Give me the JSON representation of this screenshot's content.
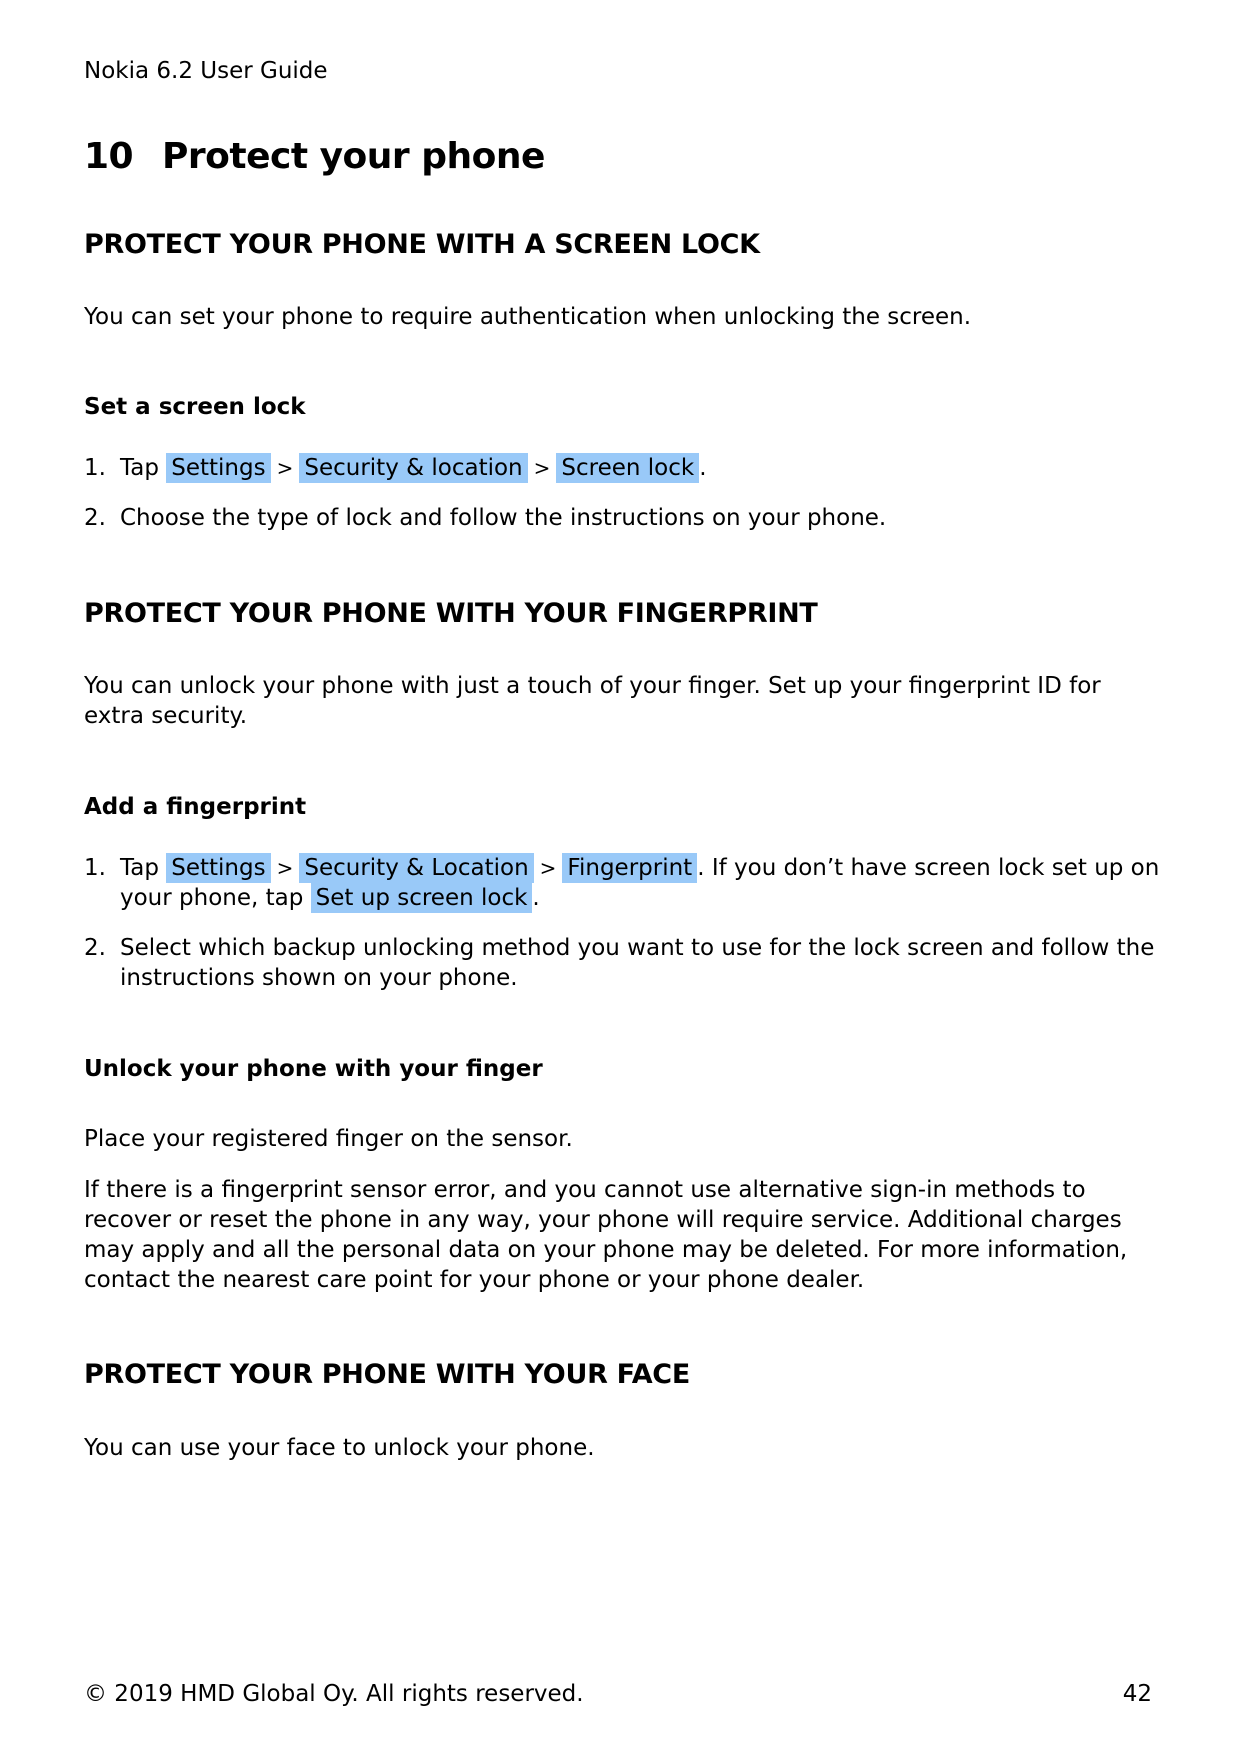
{
  "header": {
    "doc_title": "Nokia 6.2 User Guide"
  },
  "chapter": {
    "number": "10",
    "title": "Protect your phone"
  },
  "sections": {
    "screen_lock": {
      "heading": "PROTECT YOUR PHONE WITH A SCREEN LOCK",
      "intro": "You can set your phone to require authentication when unlocking the screen.",
      "subheading": "Set a screen lock",
      "steps": [
        {
          "number": "1.",
          "prefix": "Tap",
          "path": [
            "Settings",
            "Security & location",
            "Screen lock"
          ],
          "separator": ">",
          "suffix": "."
        },
        {
          "number": "2.",
          "text": "Choose the type of lock and follow the instructions on your phone."
        }
      ]
    },
    "fingerprint": {
      "heading": "PROTECT YOUR PHONE WITH YOUR FINGERPRINT",
      "intro": "You can unlock your phone with just a touch of your finger. Set up your fingerprint ID for extra security.",
      "subheading": "Add a fingerprint",
      "steps": [
        {
          "number": "1.",
          "prefix": "Tap",
          "path": [
            "Settings",
            "Security & Location",
            "Fingerprint"
          ],
          "separator": ">",
          "middle": ". If you don’t have screen lock set up on your phone, tap",
          "link": "Set up screen lock",
          "suffix": "."
        },
        {
          "number": "2.",
          "text": "Select which backup unlocking method you want to use for the lock screen and follow the instructions shown on your phone."
        }
      ],
      "unlock_subheading": "Unlock your phone with your finger",
      "unlock_text": "Place your registered finger on the sensor.",
      "warning_text": "If there is a fingerprint sensor error, and you cannot use alternative sign-in methods to recover or reset the phone in any way, your phone will require service. Additional charges may apply and all the personal data on your phone may be deleted. For more information, contact the nearest care point for your phone or your phone dealer."
    },
    "face": {
      "heading": "PROTECT YOUR PHONE WITH YOUR FACE",
      "intro": "You can use your face to unlock your phone."
    }
  },
  "footer": {
    "copyright": "© 2019 HMD Global Oy. All rights reserved.",
    "page_number": "42"
  },
  "colors": {
    "highlight": "#99c9f8",
    "text": "#000000"
  }
}
